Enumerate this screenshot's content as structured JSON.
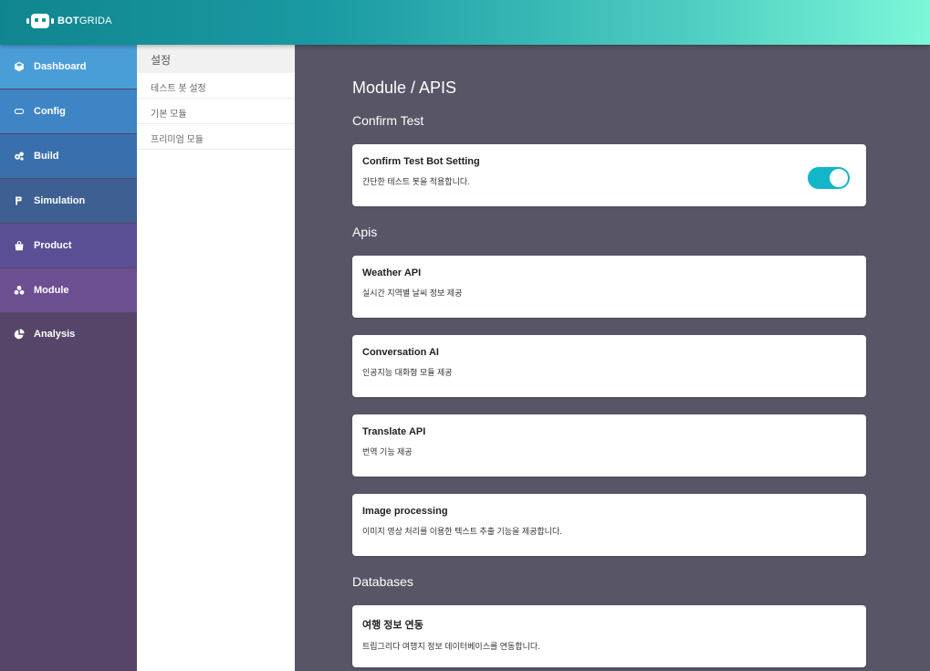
{
  "brand": {
    "logo_bold": "BOT",
    "logo_rest": "GRIDA"
  },
  "colors": {
    "accent": "#12b6c8",
    "sidebar_bg": "#574569",
    "main_bg": "#585566"
  },
  "sidebar": {
    "items": [
      {
        "label": "Dashboard",
        "icon": "cube-icon",
        "color": "#4a9ed8"
      },
      {
        "label": "Config",
        "icon": "toggle-icon",
        "color": "#3f84c4"
      },
      {
        "label": "Build",
        "icon": "gears-icon",
        "color": "#3a6fad"
      },
      {
        "label": "Simulation",
        "icon": "branch-icon",
        "color": "#3e5f92"
      },
      {
        "label": "Product",
        "icon": "shopping-bag-icon",
        "color": "#5a4f94"
      },
      {
        "label": "Module",
        "icon": "cubes-icon",
        "color": "#6b4f91",
        "active": true
      },
      {
        "label": "Analysis",
        "icon": "pie-chart-icon",
        "color": "#574569"
      }
    ]
  },
  "subnav": {
    "header": "설정",
    "items": [
      "테스트 봇 설정",
      "기본 모듈",
      "프리미엄 모듈"
    ]
  },
  "main": {
    "title": "Module / APIS",
    "sections": {
      "confirm": "Confirm Test",
      "apis": "Apis",
      "databases": "Databases"
    },
    "cards": {
      "confirm": {
        "title": "Confirm Test Bot Setting",
        "desc": "간단한 테스트 봇을 적용합니다.",
        "toggle_on": true
      },
      "weather": {
        "title": "Weather API",
        "desc": "실시간 지역별 날씨 정보 제공"
      },
      "conversation": {
        "title": "Conversation AI",
        "desc": "인공지능 대화형 모듈 제공"
      },
      "translate": {
        "title": "Translate API",
        "desc": "번역 기능 제공"
      },
      "image": {
        "title": "Image processing",
        "desc": "이미지 영상 처리를 이용한 텍스트 추출 기능을 제공합니다."
      },
      "travel": {
        "title": "여행 정보 연동",
        "desc": "트립그리다 여행지 정보 데이터베이스를 연동합니다."
      }
    }
  }
}
